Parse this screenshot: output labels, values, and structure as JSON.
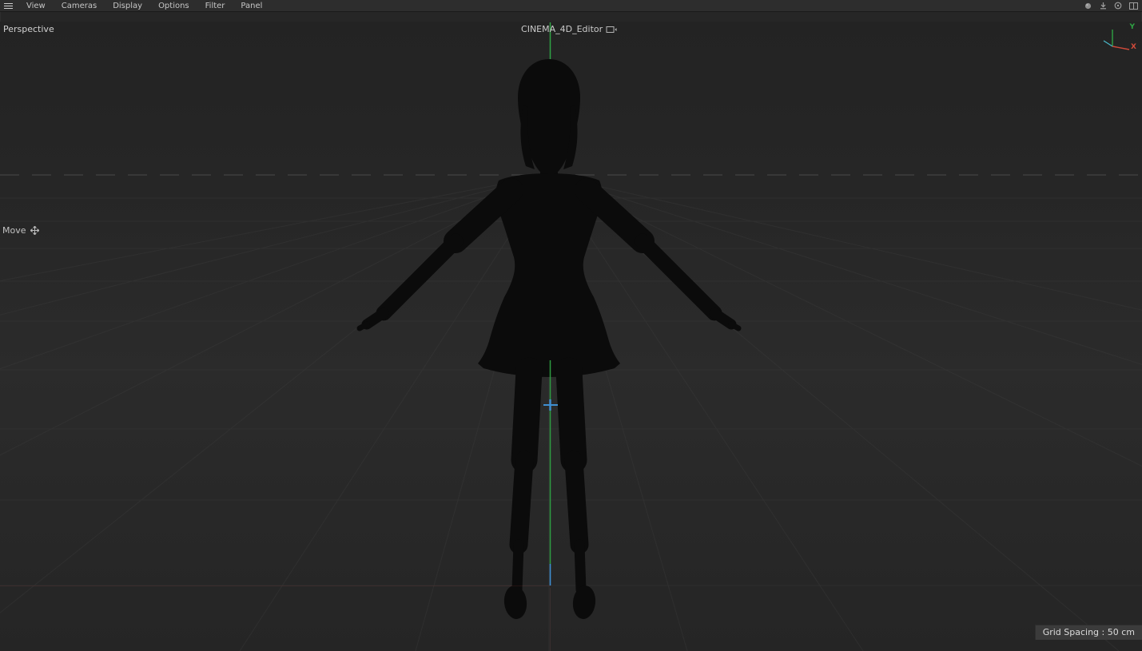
{
  "menu_bar": {
    "items": [
      "View",
      "Cameras",
      "Display",
      "Options",
      "Filter",
      "Panel"
    ]
  },
  "viewport": {
    "camera_label": "Perspective",
    "editor_title": "CINEMA_4D_Editor",
    "tool_label": "Move",
    "axis_gizmo": {
      "y_label": "Y",
      "x_label": "X"
    },
    "status_bar": {
      "grid_spacing": "Grid Spacing : 50 cm"
    }
  },
  "icons": {
    "hamburger": "hamburger-menu",
    "top_right": [
      "sphere",
      "arrow-down",
      "target",
      "layout-columns"
    ],
    "editor_monitor": "monitor-with-triangle",
    "move_cross": "four-way-move-arrows"
  },
  "colors": {
    "menu_bg": "#2d2d2d",
    "viewport_bg": "#272727",
    "text": "#c6c6c6",
    "axis_x": "#d04a3a",
    "axis_y": "#2fa344",
    "axis_z": "#3f8fd2",
    "silhouette": "#0b0b0b",
    "grid_line": "#414141",
    "horizon_line": "#5a5a5a",
    "status_bg": "#3b3b3b"
  }
}
